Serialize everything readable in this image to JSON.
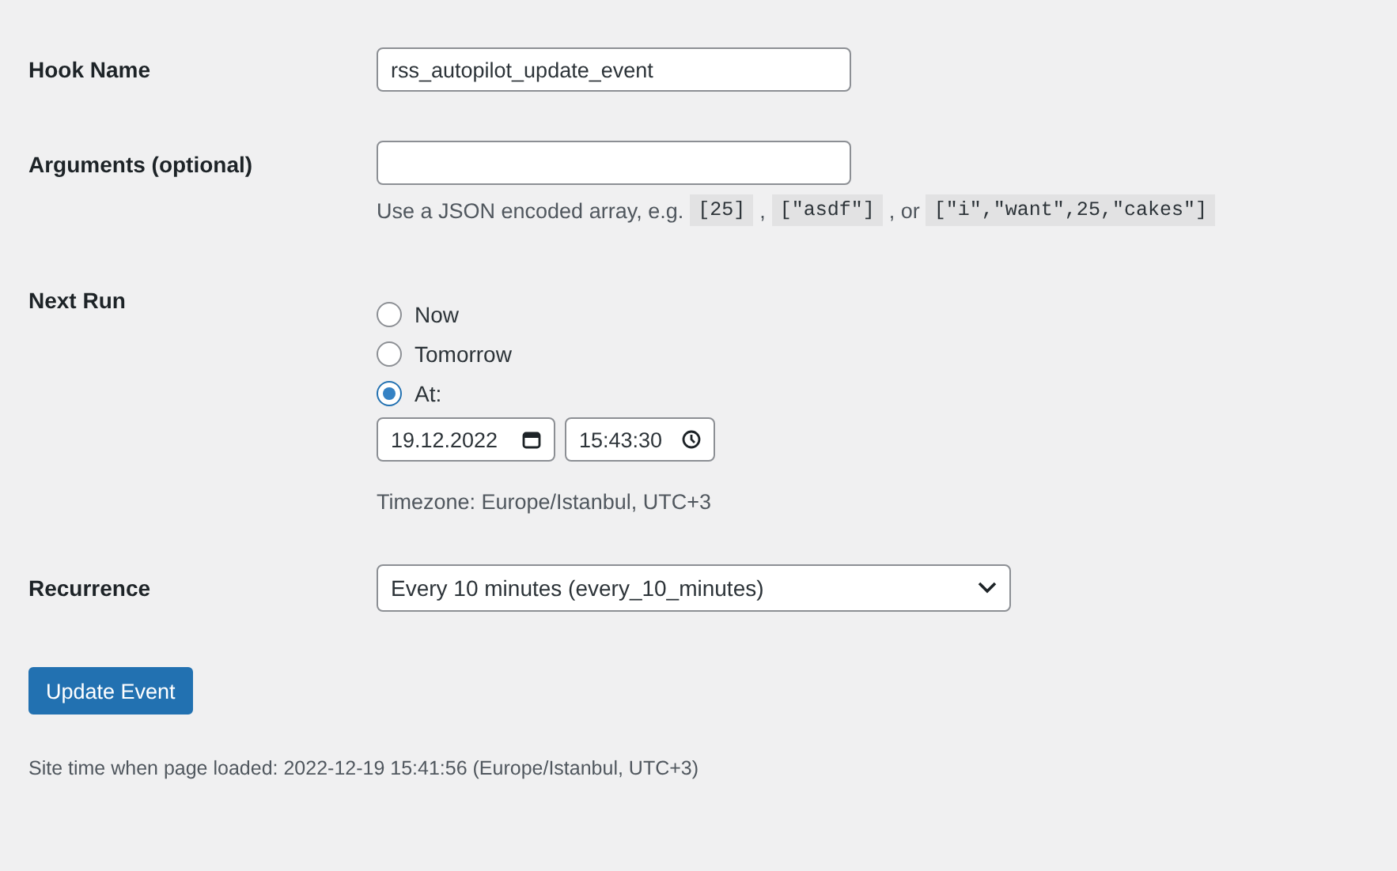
{
  "hook_name": {
    "label": "Hook Name",
    "value": "rss_autopilot_update_event"
  },
  "arguments": {
    "label": "Arguments (optional)",
    "hint": [
      {
        "kind": "text",
        "text": "Use a JSON encoded array, e.g."
      },
      {
        "kind": "code",
        "text": "[25]"
      },
      {
        "kind": "text",
        "text": ","
      },
      {
        "kind": "code",
        "text": "[\"asdf\"]"
      },
      {
        "kind": "text",
        "text": ", or"
      },
      {
        "kind": "code",
        "text": "[\"i\",\"want\",25,\"cakes\"]"
      }
    ]
  },
  "next_run": {
    "label": "Next Run",
    "options": [
      {
        "label": "Now",
        "selected": false
      },
      {
        "label": "Tomorrow",
        "selected": false
      },
      {
        "label": "At:",
        "selected": true
      }
    ],
    "date": "19.12.2022",
    "time": "15:43:30",
    "timezone": "Timezone: Europe/Istanbul, UTC+3"
  },
  "recurrence": {
    "label": "Recurrence",
    "value": "Every 10 minutes (every_10_minutes)"
  },
  "button": "Update Event",
  "footer": "Site time when page loaded: 2022-12-19 15:41:56 (Europe/Istanbul, UTC+3)"
}
